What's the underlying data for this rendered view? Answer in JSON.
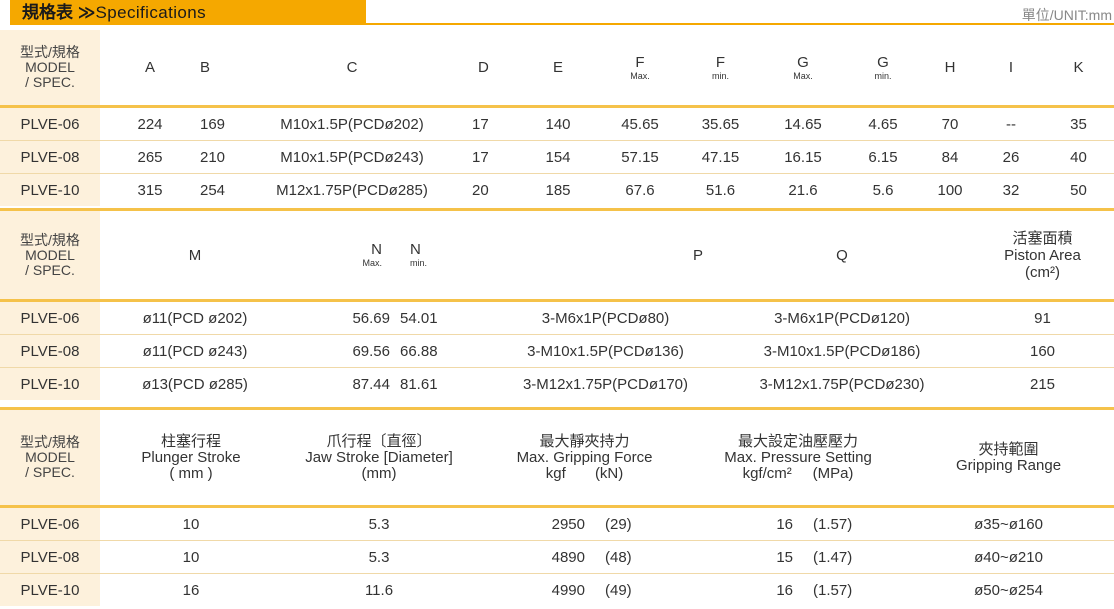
{
  "header": {
    "title_cn": "規格表",
    "title_sep": "≫",
    "title_en": "Specifications",
    "unit": "單位/UNIT:mm"
  },
  "model_header": {
    "cn": "型式/規格",
    "en1": "MODEL",
    "en2": "/ SPEC."
  },
  "table1": {
    "cols": [
      "A",
      "B",
      "C",
      "D",
      "E",
      "F",
      "F",
      "G",
      "G",
      "H",
      "I",
      "K"
    ],
    "subs": [
      "",
      "",
      "",
      "",
      "",
      "Max.",
      "min.",
      "Max.",
      "min.",
      "",
      "",
      ""
    ],
    "rows": [
      {
        "model": "PLVE-06",
        "cells": [
          "224",
          "169",
          "M10x1.5P(PCDø202)",
          "17",
          "140",
          "45.65",
          "35.65",
          "14.65",
          "4.65",
          "70",
          "--",
          "35"
        ]
      },
      {
        "model": "PLVE-08",
        "cells": [
          "265",
          "210",
          "M10x1.5P(PCDø243)",
          "17",
          "154",
          "57.15",
          "47.15",
          "16.15",
          "6.15",
          "84",
          "26",
          "40"
        ]
      },
      {
        "model": "PLVE-10",
        "cells": [
          "315",
          "254",
          "M12x1.75P(PCDø285)",
          "20",
          "185",
          "67.6",
          "51.6",
          "21.6",
          "5.6",
          "100",
          "32",
          "50"
        ]
      }
    ]
  },
  "table2": {
    "cols": [
      "M",
      "N",
      "N",
      "P",
      "Q"
    ],
    "subs": [
      "",
      "Max.",
      "min.",
      "",
      ""
    ],
    "piston": {
      "cn": "活塞面積",
      "en": "Piston Area",
      "unit": "(cm²)"
    },
    "rows": [
      {
        "model": "PLVE-06",
        "cells": [
          "ø11(PCD ø202)",
          "56.69",
          "54.01",
          "3-M6x1P(PCDø80)",
          "3-M6x1P(PCDø120)",
          "91"
        ]
      },
      {
        "model": "PLVE-08",
        "cells": [
          "ø11(PCD ø243)",
          "69.56",
          "66.88",
          "3-M10x1.5P(PCDø136)",
          "3-M10x1.5P(PCDø186)",
          "160"
        ]
      },
      {
        "model": "PLVE-10",
        "cells": [
          "ø13(PCD ø285)",
          "87.44",
          "81.61",
          "3-M12x1.75P(PCDø170)",
          "3-M12x1.75P(PCDø230)",
          "215"
        ]
      }
    ]
  },
  "table3": {
    "plunger": {
      "cn": "柱塞行程",
      "en": "Plunger Stroke",
      "unit": "( mm )"
    },
    "jaw": {
      "cn": "爪行程〔直徑〕",
      "en": "Jaw Stroke [Diameter]",
      "unit": "(mm)"
    },
    "force": {
      "cn": "最大靜夾持力",
      "en": "Max. Gripping Force",
      "unit1": "kgf",
      "unit2": "(kN)"
    },
    "pressure": {
      "cn": "最大設定油壓壓力",
      "en": "Max. Pressure Setting",
      "unit1": "kgf/cm²",
      "unit2": "(MPa)"
    },
    "range": {
      "cn": "夾持範圍",
      "en": "Gripping Range"
    },
    "rows": [
      {
        "model": "PLVE-06",
        "cells": [
          "10",
          "5.3",
          "2950",
          "(29)",
          "16",
          "(1.57)",
          "ø35~ø160"
        ]
      },
      {
        "model": "PLVE-08",
        "cells": [
          "10",
          "5.3",
          "4890",
          "(48)",
          "15",
          "(1.47)",
          "ø40~ø210"
        ]
      },
      {
        "model": "PLVE-10",
        "cells": [
          "16",
          "11.6",
          "4990",
          "(49)",
          "16",
          "(1.57)",
          "ø50~ø254"
        ]
      }
    ]
  }
}
